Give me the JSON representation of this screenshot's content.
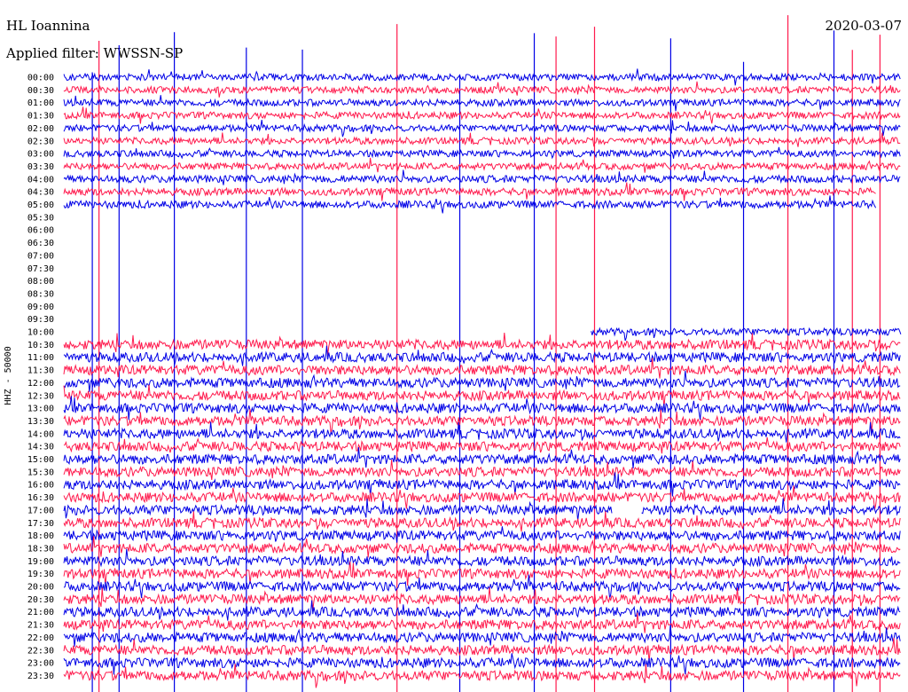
{
  "header": {
    "station": "HL Ioannina",
    "date": "2020-03-07",
    "filter": "Applied filter: WWSSN-SP"
  },
  "chart_data": {
    "type": "line",
    "title": "HL Ioannina",
    "subtitle": "Applied filter: WWSSN-SP",
    "date": "2020-03-07",
    "ylabel": "HHZ - 50000",
    "xlabel": "",
    "row_labels": [
      "00:00",
      "00:30",
      "01:00",
      "01:30",
      "02:00",
      "02:30",
      "03:00",
      "03:30",
      "04:00",
      "04:30",
      "05:00",
      "05:30",
      "06:00",
      "06:30",
      "07:00",
      "07:30",
      "08:00",
      "08:30",
      "09:00",
      "09:30",
      "10:00",
      "10:30",
      "11:00",
      "11:30",
      "12:00",
      "12:30",
      "13:00",
      "13:30",
      "14:00",
      "14:30",
      "15:00",
      "15:30",
      "16:00",
      "16:30",
      "17:00",
      "17:30",
      "18:00",
      "18:30",
      "19:00",
      "19:30",
      "20:00",
      "20:30",
      "21:00",
      "21:30",
      "22:00",
      "22:30",
      "23:00",
      "23:30"
    ],
    "series_colors": [
      "#0000e6",
      "#ff1a4d"
    ],
    "trace_extent": [
      [
        0,
        1
      ],
      [
        0,
        1
      ],
      [
        0,
        1
      ],
      [
        0,
        1
      ],
      [
        0,
        1
      ],
      [
        0,
        1
      ],
      [
        0,
        1
      ],
      [
        0,
        1
      ],
      [
        0,
        1
      ],
      [
        0,
        0.97
      ],
      [
        0,
        0.97
      ],
      null,
      null,
      null,
      null,
      null,
      null,
      null,
      null,
      null,
      [
        0.63,
        1
      ],
      [
        0,
        1
      ],
      [
        0,
        1
      ],
      [
        0,
        1
      ],
      [
        0,
        1
      ],
      [
        0,
        1
      ],
      [
        0,
        1
      ],
      [
        0,
        1
      ],
      [
        0,
        1
      ],
      [
        0,
        1
      ],
      [
        0,
        1
      ],
      [
        0,
        1
      ],
      [
        0,
        1
      ],
      [
        0,
        1
      ],
      [
        0,
        1
      ],
      [
        0,
        1
      ],
      [
        0,
        1
      ],
      [
        0,
        1
      ],
      [
        0,
        1
      ],
      [
        0,
        1
      ],
      [
        0,
        1
      ],
      [
        0,
        1
      ],
      [
        0,
        1
      ],
      [
        0,
        1
      ],
      [
        0,
        1
      ],
      [
        0,
        1
      ],
      [
        0,
        1
      ],
      [
        0,
        1
      ]
    ],
    "noise_level": [
      0.5,
      0.5,
      0.5,
      0.5,
      0.5,
      0.5,
      0.5,
      0.5,
      0.6,
      0.6,
      0.6,
      0,
      0,
      0,
      0,
      0,
      0,
      0,
      0,
      0,
      0.55,
      1,
      1,
      1,
      1,
      1,
      1,
      1,
      1,
      1,
      1,
      1,
      1,
      1,
      1,
      1,
      1,
      1,
      1,
      1,
      1,
      1,
      1,
      1,
      1,
      1,
      1,
      1
    ],
    "gap": {
      "row": "17:00",
      "x_range": [
        0.655,
        0.69
      ]
    },
    "spikes": [
      {
        "x": 0.034,
        "color": "#0000e6"
      },
      {
        "x": 0.042,
        "color": "#ff1a4d"
      },
      {
        "x": 0.066,
        "color": "#0000e6"
      },
      {
        "x": 0.132,
        "color": "#0000e6"
      },
      {
        "x": 0.218,
        "color": "#0000e6"
      },
      {
        "x": 0.285,
        "color": "#0000e6"
      },
      {
        "x": 0.398,
        "color": "#ff1a4d"
      },
      {
        "x": 0.473,
        "color": "#0000e6"
      },
      {
        "x": 0.562,
        "color": "#0000e6"
      },
      {
        "x": 0.588,
        "color": "#ff1a4d"
      },
      {
        "x": 0.634,
        "color": "#ff1a4d"
      },
      {
        "x": 0.725,
        "color": "#0000e6"
      },
      {
        "x": 0.812,
        "color": "#0000e6"
      },
      {
        "x": 0.865,
        "color": "#ff1a4d"
      },
      {
        "x": 0.92,
        "color": "#0000e6"
      },
      {
        "x": 0.942,
        "color": "#ff1a4d"
      },
      {
        "x": 0.975,
        "color": "#ff1a4d"
      }
    ]
  }
}
